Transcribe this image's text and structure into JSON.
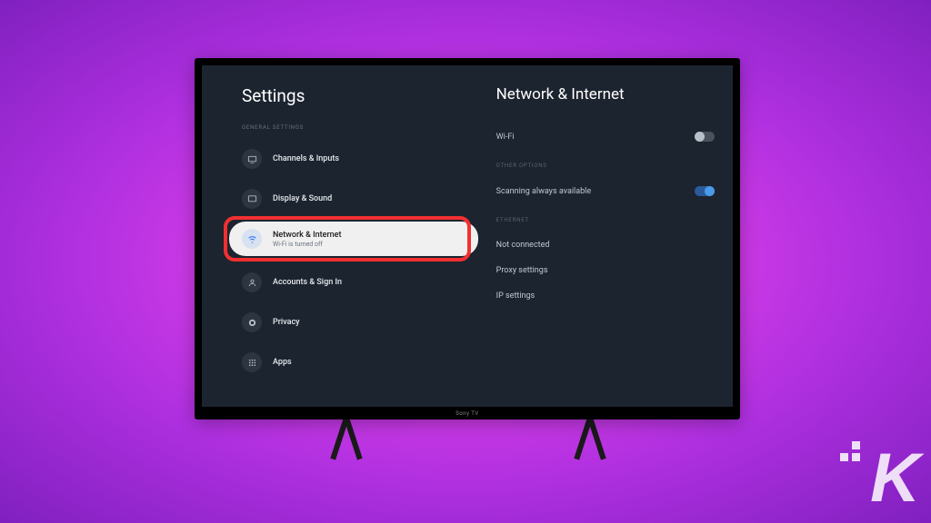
{
  "tv": {
    "brand": "Sony TV"
  },
  "left": {
    "title": "Settings",
    "section": "GENERAL SETTINGS",
    "items": [
      {
        "label": "Channels & Inputs"
      },
      {
        "label": "Display & Sound"
      },
      {
        "label": "Network & Internet",
        "sublabel": "Wi-Fi is turned off"
      },
      {
        "label": "Accounts & Sign In"
      },
      {
        "label": "Privacy"
      },
      {
        "label": "Apps"
      }
    ]
  },
  "right": {
    "title": "Network & Internet",
    "wifi_label": "Wi-Fi",
    "other_section": "OTHER OPTIONS",
    "scanning_label": "Scanning always available",
    "ethernet_section": "ETHERNET",
    "not_connected": "Not connected",
    "proxy": "Proxy settings",
    "ip": "IP settings"
  }
}
